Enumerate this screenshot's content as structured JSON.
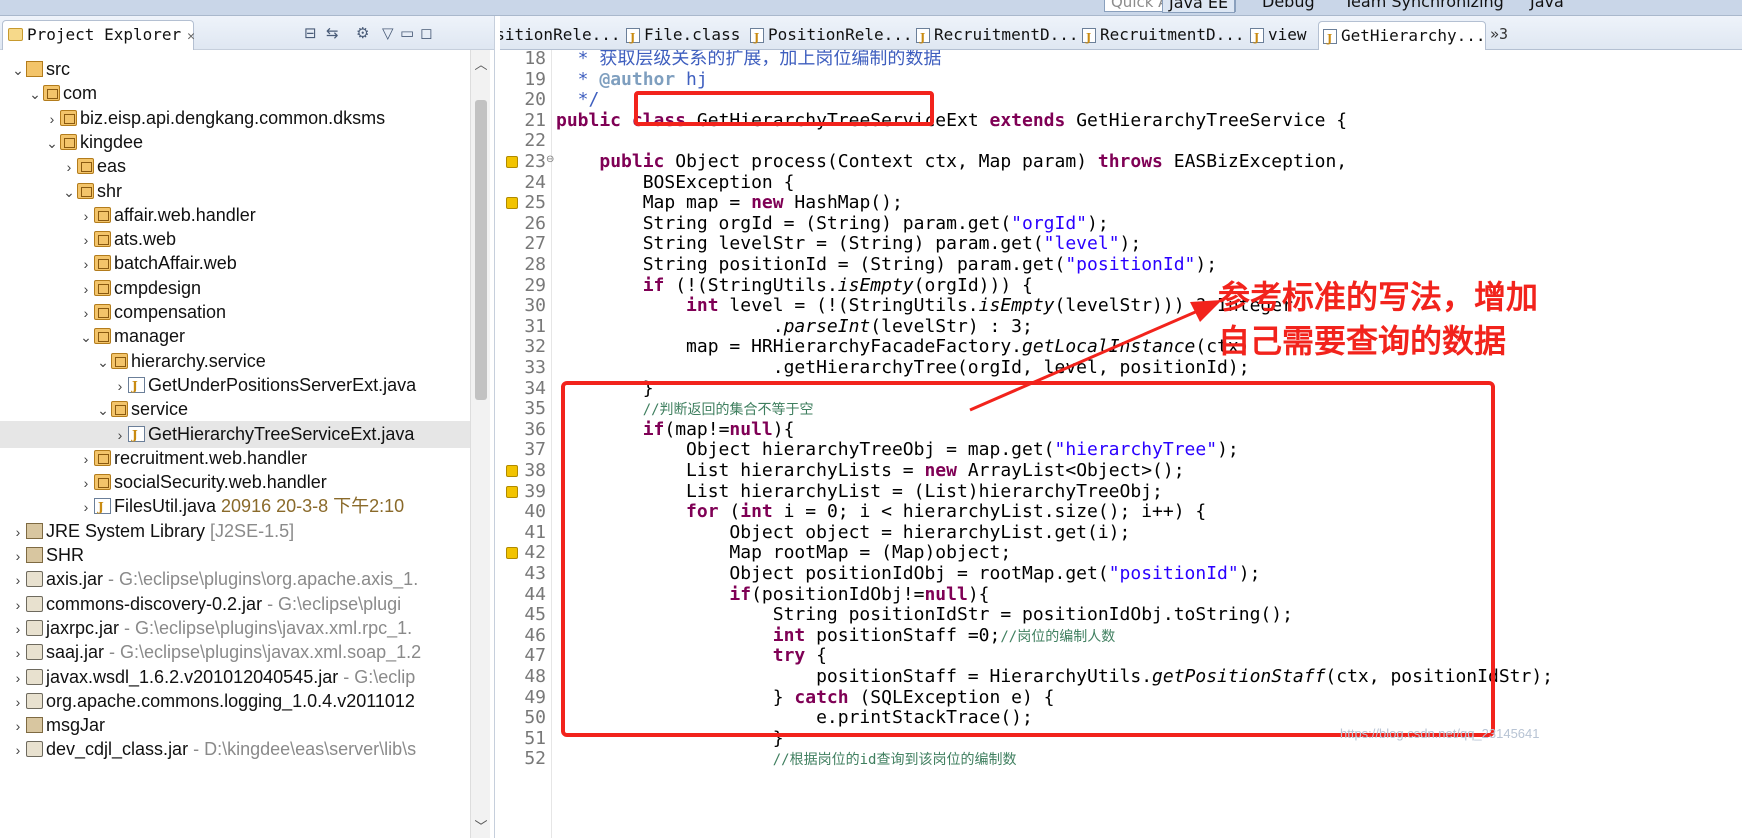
{
  "toolbar": {
    "quick_access_placeholder": "Quick Access",
    "perspectives": [
      "Java EE",
      "Debug",
      "Team Synchronizing",
      "Java"
    ]
  },
  "explorer": {
    "title": "Project Explorer",
    "close_glyph": "✕",
    "tree": [
      {
        "label": "src",
        "depth": 1,
        "expanded": true,
        "icon": "source-folder-icon"
      },
      {
        "label": "com",
        "depth": 2,
        "expanded": true,
        "icon": "package-icon"
      },
      {
        "label": "biz.eisp.api.dengkang.common.dksms",
        "depth": 3,
        "expanded": false,
        "icon": "package-icon"
      },
      {
        "label": "kingdee",
        "depth": 3,
        "expanded": true,
        "icon": "package-icon"
      },
      {
        "label": "eas",
        "depth": 4,
        "expanded": false,
        "icon": "package-icon"
      },
      {
        "label": "shr",
        "depth": 4,
        "expanded": true,
        "icon": "package-icon"
      },
      {
        "label": "affair.web.handler",
        "depth": 5,
        "expanded": false,
        "icon": "package-icon"
      },
      {
        "label": "ats.web",
        "depth": 5,
        "expanded": false,
        "icon": "package-icon"
      },
      {
        "label": "batchAffair.web",
        "depth": 5,
        "expanded": false,
        "icon": "package-icon"
      },
      {
        "label": "cmpdesign",
        "depth": 5,
        "expanded": false,
        "icon": "package-icon"
      },
      {
        "label": "compensation",
        "depth": 5,
        "expanded": false,
        "icon": "package-icon"
      },
      {
        "label": "manager",
        "depth": 5,
        "expanded": true,
        "icon": "package-icon"
      },
      {
        "label": "hierarchy.service",
        "depth": 6,
        "expanded": true,
        "icon": "package-icon"
      },
      {
        "label": "GetUnderPositionsServerExt.java",
        "depth": 7,
        "expanded": false,
        "icon": "java-file-icon"
      },
      {
        "label": "service",
        "depth": 6,
        "expanded": true,
        "icon": "package-icon"
      },
      {
        "label": "GetHierarchyTreeServiceExt.java",
        "depth": 7,
        "expanded": false,
        "icon": "java-file-icon",
        "selected": true
      },
      {
        "label": "recruitment.web.handler",
        "depth": 5,
        "expanded": false,
        "icon": "package-icon"
      },
      {
        "label": "socialSecurity.web.handler",
        "depth": 5,
        "expanded": false,
        "icon": "package-icon"
      },
      {
        "label": "FilesUtil.java",
        "depth": 5,
        "expanded": false,
        "icon": "java-file-icon",
        "suffix": " 20916  20-3-8 下午2:10"
      },
      {
        "label": "JRE System Library",
        "depth": 1,
        "expanded": false,
        "icon": "library-icon",
        "suffix": " [J2SE-1.5]"
      },
      {
        "label": "SHR",
        "depth": 1,
        "expanded": false,
        "icon": "library-icon"
      },
      {
        "label": "axis.jar",
        "depth": 1,
        "expanded": false,
        "icon": "jar-icon",
        "suffix": " - G:\\eclipse\\plugins\\org.apache.axis_1."
      },
      {
        "label": "commons-discovery-0.2.jar",
        "depth": 1,
        "expanded": false,
        "icon": "jar-icon",
        "suffix": " - G:\\eclipse\\plugi"
      },
      {
        "label": "jaxrpc.jar",
        "depth": 1,
        "expanded": false,
        "icon": "jar-icon",
        "suffix": " - G:\\eclipse\\plugins\\javax.xml.rpc_1."
      },
      {
        "label": "saaj.jar",
        "depth": 1,
        "expanded": false,
        "icon": "jar-icon",
        "suffix": " - G:\\eclipse\\plugins\\javax.xml.soap_1.2"
      },
      {
        "label": "javax.wsdl_1.6.2.v201012040545.jar",
        "depth": 1,
        "expanded": false,
        "icon": "jar-icon",
        "suffix": " - G:\\eclip"
      },
      {
        "label": "org.apache.commons.logging_1.0.4.v2011012",
        "depth": 1,
        "expanded": false,
        "icon": "jar-icon"
      },
      {
        "label": "msgJar",
        "depth": 1,
        "expanded": false,
        "icon": "library-icon"
      },
      {
        "label": "dev_cdjl_class.jar",
        "depth": 1,
        "expanded": false,
        "icon": "jar-icon",
        "suffix": " - D:\\kingdee\\eas\\server\\lib\\s"
      }
    ]
  },
  "editor": {
    "tabs": [
      {
        "label": "positionRele...",
        "active": false
      },
      {
        "label": "File.class",
        "active": false
      },
      {
        "label": "PositionRele...",
        "active": false
      },
      {
        "label": "RecruitmentD...",
        "active": false
      },
      {
        "label": "RecruitmentD...",
        "active": false
      },
      {
        "label": "view",
        "active": false
      },
      {
        "label": "GetHierarchy...",
        "active": true
      }
    ],
    "more_tabs_label": "»3",
    "line_numbers": [
      "18",
      "19",
      "20",
      "21",
      "22",
      "23",
      "24",
      "25",
      "26",
      "27",
      "28",
      "29",
      "30",
      "31",
      "32",
      "33",
      "34",
      "35",
      "36",
      "37",
      "38",
      "39",
      "40",
      "41",
      "42",
      "43",
      "44",
      "45",
      "46",
      "47",
      "48",
      "49",
      "50",
      "51",
      "52"
    ],
    "code_lines": [
      "  * 获取层级关系的扩展，加上岗位编制的数据",
      "  * @author hj",
      "  */",
      "public class GetHierarchyTreeServiceExt extends GetHierarchyTreeService {",
      "",
      "    public Object process(Context ctx, Map param) throws EASBizException,",
      "        BOSException {",
      "        Map map = new HashMap();",
      "        String orgId = (String) param.get(\"orgId\");",
      "        String levelStr = (String) param.get(\"level\");",
      "        String positionId = (String) param.get(\"positionId\");",
      "        if (!(StringUtils.isEmpty(orgId))) {",
      "            int level = (!(StringUtils.isEmpty(levelStr))) ? Integer",
      "                    .parseInt(levelStr) : 3;",
      "            map = HRHierarchyFacadeFactory.getLocalInstance(ctx)",
      "                    .getHierarchyTree(orgId, level, positionId);",
      "        }",
      "        //判断返回的集合不等于空",
      "        if(map!=null){",
      "            Object hierarchyTreeObj = map.get(\"hierarchyTree\");",
      "            List hierarchyLists = new ArrayList<Object>();",
      "            List hierarchyList = (List)hierarchyTreeObj;",
      "            for (int i = 0; i < hierarchyList.size(); i++) {",
      "                Object object = hierarchyList.get(i);",
      "                Map rootMap = (Map)object;",
      "                Object positionIdObj = rootMap.get(\"positionId\");",
      "                if(positionIdObj!=null){",
      "                    String positionIdStr = positionIdObj.toString();",
      "                    int positionStaff =0;//岗位的编制人数",
      "                    try {",
      "                        positionStaff = HierarchyUtils.getPositionStaff(ctx, positionIdStr);",
      "                    } catch (SQLException e) {",
      "                        e.printStackTrace();",
      "                    }",
      "                    //根据岗位的id查询到该岗位的编制数"
    ]
  },
  "annotation": {
    "note_line1": "参考标准的写法，增加",
    "note_line2": "自己需要查询的数据",
    "color": "#f2231c"
  },
  "watermark": "https://blog.csdn.net/qq_23145641"
}
